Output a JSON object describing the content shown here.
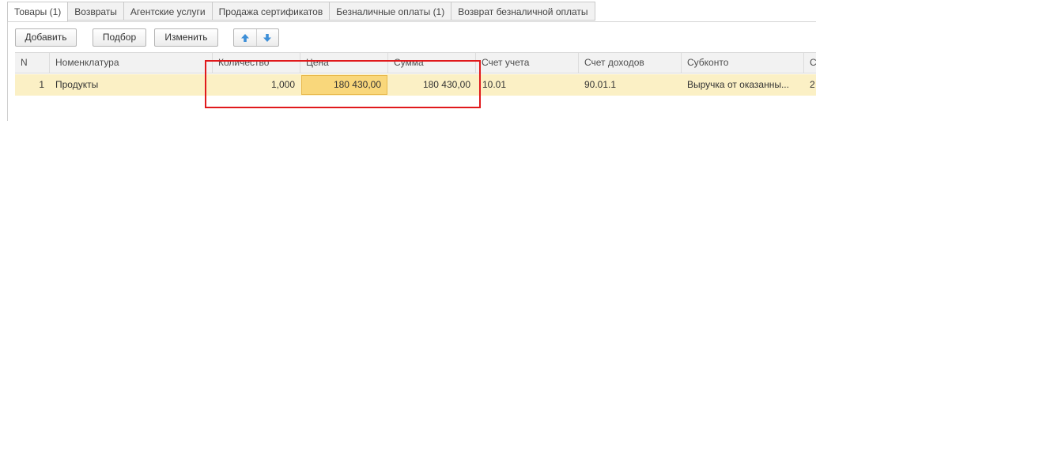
{
  "tabs": [
    {
      "label": "Товары (1)",
      "active": true
    },
    {
      "label": "Возвраты",
      "active": false
    },
    {
      "label": "Агентские услуги",
      "active": false
    },
    {
      "label": "Продажа сертификатов",
      "active": false
    },
    {
      "label": "Безналичные оплаты (1)",
      "active": false
    },
    {
      "label": "Возврат безналичной оплаты",
      "active": false
    }
  ],
  "toolbar": {
    "add_label": "Добавить",
    "select_label": "Подбор",
    "edit_label": "Изменить",
    "up_icon": "arrow-up-icon",
    "down_icon": "arrow-down-icon"
  },
  "table": {
    "columns": [
      "N",
      "Номенклатура",
      "Количество",
      "Цена",
      "Сумма",
      "Счет учета",
      "Счет доходов",
      "Субконто",
      "С"
    ],
    "rows": [
      [
        "1",
        "Продукты",
        "1,000",
        "180 430,00",
        "180 430,00",
        "10.01",
        "90.01.1",
        "Выручка от оказанны...",
        "2"
      ]
    ]
  },
  "colors": {
    "row_selected": "#fbf0c5",
    "cell_focused": "#f9d77b",
    "annotation": "#e0191c",
    "arrow_icon": "#3d8fd8"
  }
}
